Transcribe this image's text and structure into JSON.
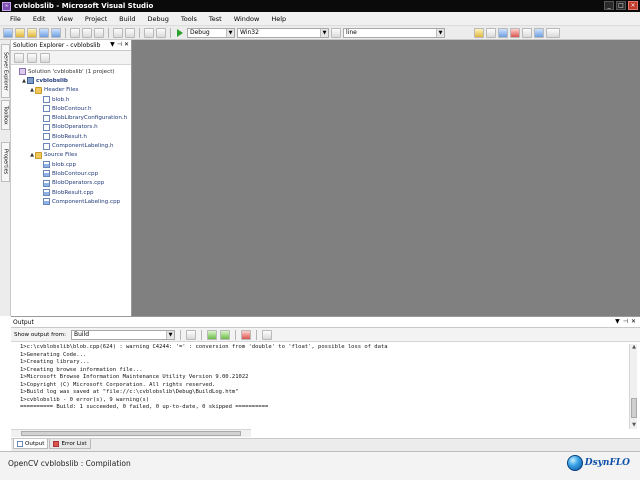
{
  "window": {
    "title": "cvblobslib - Microsoft Visual Studio"
  },
  "menu": [
    "File",
    "Edit",
    "View",
    "Project",
    "Build",
    "Debug",
    "Tools",
    "Test",
    "Window",
    "Help"
  ],
  "toolbar": {
    "config": "Debug",
    "platform": "Win32",
    "find": "line"
  },
  "left_strip": {
    "tabs": [
      "Server Explorer",
      "Toolbox",
      "Properties"
    ]
  },
  "solution_explorer": {
    "title": "Solution Explorer - cvblobslib",
    "tree": [
      {
        "label": "Solution 'cvblobslib' (1 project)",
        "depth": 0,
        "icon": "solution-icon",
        "expanded": "",
        "bold": false
      },
      {
        "label": "cvblobslib",
        "depth": 1,
        "icon": "project-icon",
        "expanded": "▲",
        "bold": true
      },
      {
        "label": "Header Files",
        "depth": 2,
        "icon": "folder-icon",
        "expanded": "▲",
        "bold": false
      },
      {
        "label": "blob.h",
        "depth": 3,
        "icon": "header-file-icon",
        "expanded": "",
        "bold": false
      },
      {
        "label": "BlobContour.h",
        "depth": 3,
        "icon": "header-file-icon",
        "expanded": "",
        "bold": false
      },
      {
        "label": "BlobLibraryConfiguration.h",
        "depth": 3,
        "icon": "header-file-icon",
        "expanded": "",
        "bold": false
      },
      {
        "label": "BlobOperators.h",
        "depth": 3,
        "icon": "header-file-icon",
        "expanded": "",
        "bold": false
      },
      {
        "label": "BlobResult.h",
        "depth": 3,
        "icon": "header-file-icon",
        "expanded": "",
        "bold": false
      },
      {
        "label": "ComponentLabeling.h",
        "depth": 3,
        "icon": "header-file-icon",
        "expanded": "",
        "bold": false
      },
      {
        "label": "Source Files",
        "depth": 2,
        "icon": "folder-icon",
        "expanded": "▲",
        "bold": false
      },
      {
        "label": "blob.cpp",
        "depth": 3,
        "icon": "cpp-file-icon",
        "expanded": "",
        "bold": false
      },
      {
        "label": "BlobContour.cpp",
        "depth": 3,
        "icon": "cpp-file-icon",
        "expanded": "",
        "bold": false
      },
      {
        "label": "BlobOperators.cpp",
        "depth": 3,
        "icon": "cpp-file-icon",
        "expanded": "",
        "bold": false
      },
      {
        "label": "BlobResult.cpp",
        "depth": 3,
        "icon": "cpp-file-icon",
        "expanded": "",
        "bold": false
      },
      {
        "label": "ComponentLabeling.cpp",
        "depth": 3,
        "icon": "cpp-file-icon",
        "expanded": "",
        "bold": false
      }
    ]
  },
  "output": {
    "title": "Output",
    "show_output_from_label": "Show output from:",
    "show_output_from_value": "Build",
    "lines": [
      "1>c:\\cvblobslib\\blob.cpp(624) : warning C4244: '=' : conversion from 'double' to 'float', possible loss of data",
      "1>Generating Code...",
      "1>Creating library...",
      "1>Creating browse information file...",
      "1>Microsoft Browse Information Maintenance Utility Version 9.00.21022",
      "1>Copyright (C) Microsoft Corporation. All rights reserved.",
      "1>Build log was saved at \"file://c:\\cvblobslib\\Debug\\BuildLog.htm\"",
      "1>cvblobslib - 0 error(s), 9 warning(s)",
      "========== Build: 1 succeeded, 0 failed, 0 up-to-date, 0 skipped =========="
    ],
    "tabs": [
      "Output",
      "Error List"
    ]
  },
  "status": {
    "text": "OpenCV cvblobslib : Compilation"
  },
  "brand": {
    "text": "DsynFLO"
  }
}
